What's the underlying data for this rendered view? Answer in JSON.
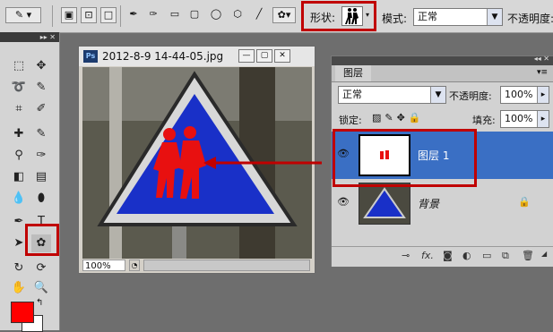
{
  "options_bar": {
    "shape_label": "形状:",
    "mode_label": "模式:",
    "mode_value": "正常",
    "opacity_label": "不透明度:"
  },
  "document": {
    "title": "2012-8-9 14-44-05.jpg",
    "zoom": "100%",
    "ps_badge": "Ps"
  },
  "layers_panel": {
    "tab": "图层",
    "blend_mode": "正常",
    "opacity_label": "不透明度:",
    "opacity_value": "100%",
    "lock_label": "锁定:",
    "fill_label": "填充:",
    "fill_value": "100%",
    "layers": [
      {
        "name": "图层 1",
        "selected": true
      },
      {
        "name": "背景",
        "selected": false,
        "locked": true
      }
    ]
  },
  "colors": {
    "foreground": "#ff0000",
    "background": "#ffffff",
    "highlight": "#c00000",
    "selection": "#3a6fc4"
  }
}
